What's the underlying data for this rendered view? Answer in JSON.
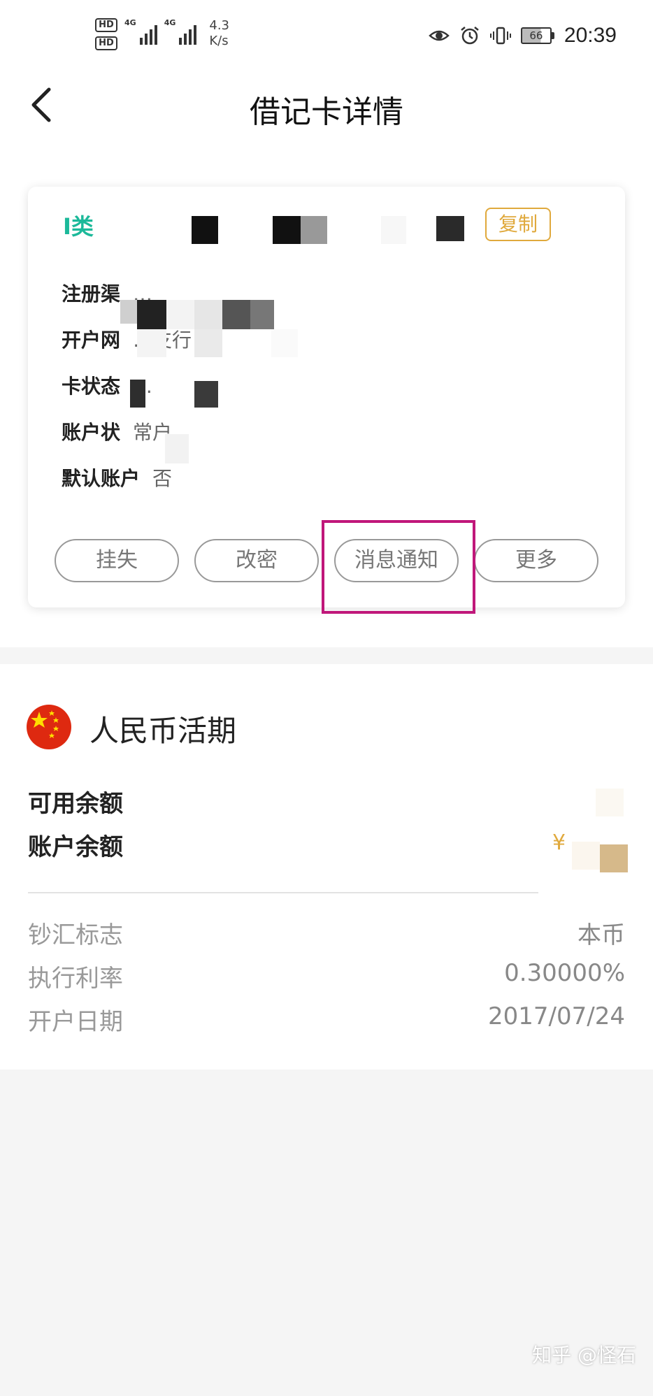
{
  "status_bar": {
    "hd1": "HD",
    "hd2": "HD",
    "net1": "4G",
    "net2": "4G",
    "speed_value": "4.3",
    "speed_unit": "K/s",
    "battery": "66",
    "time": "20:39"
  },
  "nav": {
    "title": "借记卡详情"
  },
  "card": {
    "type_label": "I类",
    "copy_label": "复制",
    "info": [
      {
        "key": "注册渠",
        "value": "…"
      },
      {
        "key": "开户网",
        "value": "…支行"
      },
      {
        "key": "卡状态",
        "value": "…"
      },
      {
        "key": "账户状",
        "value": "常户"
      },
      {
        "key": "默认账户",
        "value": "否"
      }
    ],
    "actions": {
      "report_loss": "挂失",
      "change_pwd": "改密",
      "notify": "消息通知",
      "more": "更多"
    }
  },
  "account": {
    "title": "人民币活期",
    "available_label": "可用余额",
    "balance_label": "账户余额",
    "currency_sign": "¥",
    "details": [
      {
        "label": "钞汇标志",
        "value": "本币"
      },
      {
        "label": "执行利率",
        "value": "0.30000%"
      },
      {
        "label": "开户日期",
        "value": "2017/07/24"
      }
    ]
  },
  "watermark": "知乎 @怪石",
  "colors": {
    "accent_green": "#1cb99a",
    "accent_gold": "#e0a93c",
    "highlight": "#c0177a"
  }
}
